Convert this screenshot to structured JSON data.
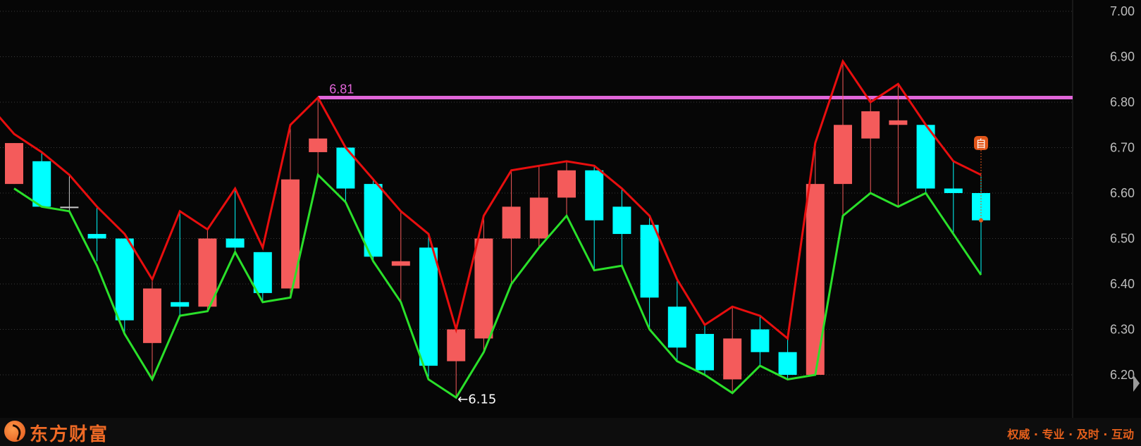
{
  "chart_data": {
    "type": "candlestick",
    "ylim": [
      6.15,
      7.0
    ],
    "y_ticks": [
      "7.00",
      "6.90",
      "6.80",
      "6.70",
      "6.60",
      "6.50",
      "6.40",
      "6.30",
      "6.20"
    ],
    "grid": true,
    "candles": [
      {
        "open": 6.62,
        "close": 6.71,
        "high": 6.71,
        "low": 6.62
      },
      {
        "open": 6.67,
        "close": 6.57,
        "high": 6.69,
        "low": 6.57
      },
      {
        "open": 6.57,
        "close": 6.57,
        "high": 6.64,
        "low": 6.56
      },
      {
        "open": 6.51,
        "close": 6.5,
        "high": 6.57,
        "low": 6.45
      },
      {
        "open": 6.5,
        "close": 6.32,
        "high": 6.5,
        "low": 6.29
      },
      {
        "open": 6.27,
        "close": 6.39,
        "high": 6.41,
        "low": 6.19
      },
      {
        "open": 6.36,
        "close": 6.35,
        "high": 6.56,
        "low": 6.33
      },
      {
        "open": 6.35,
        "close": 6.5,
        "high": 6.52,
        "low": 6.34
      },
      {
        "open": 6.5,
        "close": 6.48,
        "high": 6.61,
        "low": 6.47
      },
      {
        "open": 6.47,
        "close": 6.38,
        "high": 6.47,
        "low": 6.36
      },
      {
        "open": 6.39,
        "close": 6.63,
        "high": 6.75,
        "low": 6.37
      },
      {
        "open": 6.69,
        "close": 6.72,
        "high": 6.81,
        "low": 6.64
      },
      {
        "open": 6.7,
        "close": 6.61,
        "high": 6.7,
        "low": 6.58
      },
      {
        "open": 6.62,
        "close": 6.46,
        "high": 6.63,
        "low": 6.45
      },
      {
        "open": 6.44,
        "close": 6.45,
        "high": 6.56,
        "low": 6.36
      },
      {
        "open": 6.48,
        "close": 6.22,
        "high": 6.51,
        "low": 6.19
      },
      {
        "open": 6.23,
        "close": 6.3,
        "high": 6.3,
        "low": 6.15
      },
      {
        "open": 6.28,
        "close": 6.5,
        "high": 6.55,
        "low": 6.25
      },
      {
        "open": 6.5,
        "close": 6.57,
        "high": 6.65,
        "low": 6.4
      },
      {
        "open": 6.5,
        "close": 6.59,
        "high": 6.66,
        "low": 6.48
      },
      {
        "open": 6.59,
        "close": 6.65,
        "high": 6.67,
        "low": 6.55
      },
      {
        "open": 6.65,
        "close": 6.54,
        "high": 6.66,
        "low": 6.43
      },
      {
        "open": 6.57,
        "close": 6.51,
        "high": 6.61,
        "low": 6.44
      },
      {
        "open": 6.53,
        "close": 6.37,
        "high": 6.55,
        "low": 6.3
      },
      {
        "open": 6.35,
        "close": 6.26,
        "high": 6.41,
        "low": 6.23
      },
      {
        "open": 6.29,
        "close": 6.21,
        "high": 6.31,
        "low": 6.2
      },
      {
        "open": 6.19,
        "close": 6.28,
        "high": 6.35,
        "low": 6.16
      },
      {
        "open": 6.3,
        "close": 6.25,
        "high": 6.33,
        "low": 6.22
      },
      {
        "open": 6.25,
        "close": 6.2,
        "high": 6.28,
        "low": 6.19
      },
      {
        "open": 6.2,
        "close": 6.62,
        "high": 6.71,
        "low": 6.2
      },
      {
        "open": 6.62,
        "close": 6.75,
        "high": 6.89,
        "low": 6.55
      },
      {
        "open": 6.72,
        "close": 6.78,
        "high": 6.81,
        "low": 6.6
      },
      {
        "open": 6.75,
        "close": 6.76,
        "high": 6.84,
        "low": 6.57
      },
      {
        "open": 6.75,
        "close": 6.61,
        "high": 6.75,
        "low": 6.6
      },
      {
        "open": 6.61,
        "close": 6.6,
        "high": 6.67,
        "low": 6.51
      },
      {
        "open": 6.6,
        "close": 6.54,
        "high": 6.64,
        "low": 6.42
      }
    ],
    "colors": {
      "up": "#f45b5b",
      "down": "#00ffff",
      "flat": "#c8c8c8",
      "upper_line": "#e80e0e",
      "lower_line": "#2ae02a",
      "resistance": "#e065d8",
      "axis_text": "#bdbdbd",
      "grid": "#3a3a3a",
      "marker": "#e2561a"
    },
    "upper_line": [
      6.8,
      6.73,
      6.69,
      6.64,
      6.57,
      6.51,
      6.41,
      6.56,
      6.52,
      6.61,
      6.48,
      6.75,
      6.81,
      6.7,
      6.63,
      6.56,
      6.51,
      6.3,
      6.55,
      6.65,
      6.66,
      6.67,
      6.66,
      6.61,
      6.55,
      6.41,
      6.31,
      6.35,
      6.33,
      6.28,
      6.71,
      6.89,
      6.8,
      6.84,
      6.75,
      6.67,
      6.64
    ],
    "lower_line": [
      6.61,
      6.57,
      6.56,
      6.44,
      6.29,
      6.19,
      6.33,
      6.34,
      6.47,
      6.36,
      6.37,
      6.64,
      6.58,
      6.45,
      6.36,
      6.19,
      6.15,
      6.25,
      6.4,
      6.48,
      6.55,
      6.43,
      6.44,
      6.3,
      6.23,
      6.2,
      6.16,
      6.22,
      6.19,
      6.2,
      6.55,
      6.6,
      6.57,
      6.6,
      6.51,
      6.42
    ],
    "resistance": {
      "value": 6.81,
      "label": "6.81",
      "start_index": 11
    },
    "low_annotation": {
      "value": 6.15,
      "label": "←6.15",
      "index": 16
    },
    "marker": {
      "label": "自",
      "index": 35,
      "top_value": 6.71,
      "dot_value": 6.54
    }
  },
  "brand": {
    "name": "东方财富",
    "slogan": "权威 · 专业 · 及时 · 互动"
  }
}
